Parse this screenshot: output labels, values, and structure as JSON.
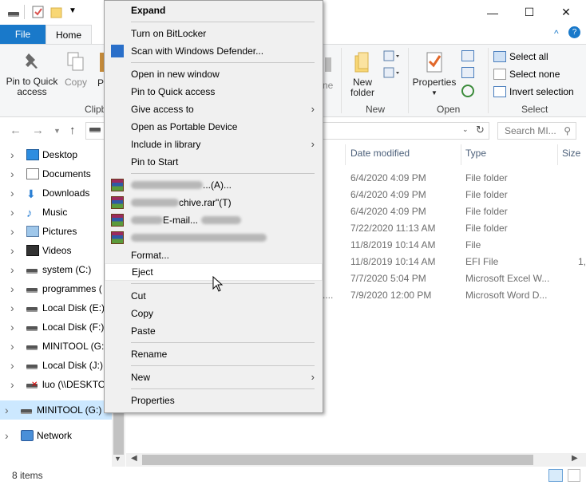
{
  "titlebar": {
    "minimize": "—",
    "maximize": "☐",
    "close": "✕",
    "expand_ribbon": "^",
    "help": "?"
  },
  "ribbon": {
    "tabs": [
      "File",
      "Home"
    ],
    "pin_quick_access": "Pin to Quick access",
    "copy": "Copy",
    "paste_partial": "P",
    "clipboard_group": "Clipb",
    "partial_label": "ne",
    "new_folder": "New folder",
    "new_group": "New",
    "properties": "Properties",
    "open_group": "Open",
    "select_all": "Select all",
    "select_none": "Select none",
    "invert_selection": "Invert selection",
    "select_group": "Select"
  },
  "address": {
    "search_placeholder": "Search MI..."
  },
  "nav": {
    "items": [
      {
        "label": "Desktop",
        "icon": "desktop-icon"
      },
      {
        "label": "Documents",
        "icon": "documents-icon"
      },
      {
        "label": "Downloads",
        "icon": "downloads-icon"
      },
      {
        "label": "Music",
        "icon": "music-icon"
      },
      {
        "label": "Pictures",
        "icon": "pictures-icon"
      },
      {
        "label": "Videos",
        "icon": "videos-icon"
      },
      {
        "label": "system (C:)",
        "icon": "drive-icon"
      },
      {
        "label": "programmes (",
        "icon": "drive-icon"
      },
      {
        "label": "Local Disk (E:)",
        "icon": "drive-icon"
      },
      {
        "label": "Local Disk (F:)",
        "icon": "drive-icon"
      },
      {
        "label": "MINITOOL (G:)",
        "icon": "drive-icon"
      },
      {
        "label": "Local Disk (J:)",
        "icon": "drive-icon"
      },
      {
        "label": "luo (\\\\DESKTO",
        "icon": "network-drive-icon"
      },
      {
        "label": "MINITOOL (G:)",
        "icon": "drive-icon"
      },
      {
        "label": "Network",
        "icon": "network-icon"
      }
    ]
  },
  "content": {
    "columns": [
      "Date modified",
      "Type",
      "Size"
    ],
    "rows": [
      {
        "date": "6/4/2020 4:09 PM",
        "type": "File folder",
        "size": ""
      },
      {
        "date": "6/4/2020 4:09 PM",
        "type": "File folder",
        "size": ""
      },
      {
        "date": "6/4/2020 4:09 PM",
        "type": "File folder",
        "size": ""
      },
      {
        "date": "7/22/2020 11:13 AM",
        "type": "File folder",
        "size": ""
      },
      {
        "date": "11/8/2019 10:14 AM",
        "type": "File",
        "size": ""
      },
      {
        "date": "11/8/2019 10:14 AM",
        "type": "EFI File",
        "size": "1,"
      },
      {
        "date": "7/7/2020 5:04 PM",
        "type": "Microsoft Excel W...",
        "size": ""
      },
      {
        "date": "7/9/2020 12:00 PM",
        "type": "Microsoft Word D...",
        "size": ""
      }
    ],
    "truncated_name": "...."
  },
  "status": {
    "item_count": "8 items"
  },
  "context_menu": {
    "expand": "Expand",
    "bitlocker": "Turn on BitLocker",
    "defender": "Scan with Windows Defender...",
    "open_new_window": "Open in new window",
    "pin_quick_access": "Pin to Quick access",
    "give_access": "Give access to",
    "open_portable": "Open as Portable Device",
    "include_library": "Include in library",
    "pin_start": "Pin to Start",
    "rar1": "...(A)...",
    "rar2": "chive.rar\"(T)",
    "rar3": "E-mail...",
    "format": "Format...",
    "eject": "Eject",
    "cut": "Cut",
    "copy": "Copy",
    "paste": "Paste",
    "rename": "Rename",
    "new": "New",
    "properties": "Properties"
  }
}
